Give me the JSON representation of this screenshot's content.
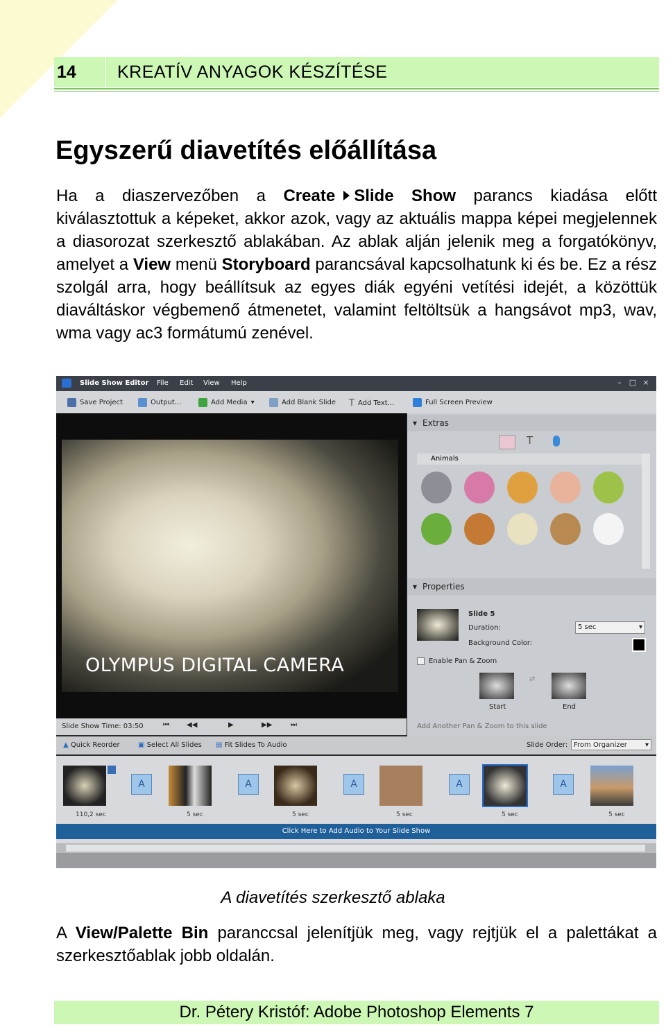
{
  "header": {
    "page_number": "14",
    "section_title": "KREATÍV ANYAGOK KÉSZÍTÉSE"
  },
  "heading": "Egyszerű diavetítés előállítása",
  "para1": {
    "t1": "Ha a diaszervezőben a ",
    "b1": "Create",
    "b2": "Slide Show",
    "t2": " parancs kiadása előtt kiválasztottuk a képeket, akkor azok, vagy az aktuális mappa képei megjelennek a diasorozat szerkesztő ablakában. Az ablak alján jelenik meg a forgatókönyv, amelyet a ",
    "b3": "View",
    "t3": " menü ",
    "b4": "Storyboard",
    "t4": " parancsával kapcsolhatunk ki és be. Ez a rész szolgál arra, hogy beállítsuk az egyes diák egyéni vetítési idejét, a közöttük diaváltáskor végbemenő átmenetet, valamint feltöltsük a hangsávot mp3, wav, wma vagy ac3 formátumú zenével."
  },
  "screenshot": {
    "window_title": "Slide Show Editor",
    "menus": [
      "File",
      "Edit",
      "View",
      "Help"
    ],
    "toolbar": [
      "Save Project",
      "Output...",
      "Add Media",
      "Add Blank Slide",
      "Add Text...",
      "Full Screen Preview"
    ],
    "photo_caption": "OLYMPUS DIGITAL CAMERA",
    "extras_label": "Extras",
    "animals_label": "Animals",
    "properties_label": "Properties",
    "slide_label": "Slide 5",
    "duration_label": "Duration:",
    "duration_value": "5 sec",
    "bgcolor_label": "Background Color:",
    "pan_zoom_label": "Enable Pan & Zoom",
    "start_label": "Start",
    "end_label": "End",
    "add_pan_zoom": "Add Another Pan & Zoom to this slide",
    "show_time": "Slide Show Time: 03:50",
    "quick_reorder": "Quick Reorder",
    "select_all": "Select All Slides",
    "fit_audio": "Fit Slides To Audio",
    "slide_order_label": "Slide Order:",
    "slide_order_value": "From Organizer",
    "durations": [
      "110,2 sec",
      "5 sec",
      "5 sec",
      "5 sec",
      "5 sec",
      "5 sec"
    ],
    "audio_prompt": "Click Here to Add Audio to Your Slide Show",
    "colors": {
      "titlebar": "#3a3f48",
      "panel": "#c9ccd0",
      "audio": "#1f5f9a"
    }
  },
  "caption": "A diavetítés szerkesztő ablaka",
  "para2": {
    "t1": "A ",
    "b1": "View/Palette Bin",
    "t2": " paranccsal jelenítjük meg, vagy rejtjük el a palettákat a szerkesztőablak jobb oldalán."
  },
  "footer": "Dr. Pétery Kristóf: Adobe Photoshop Elements 7"
}
